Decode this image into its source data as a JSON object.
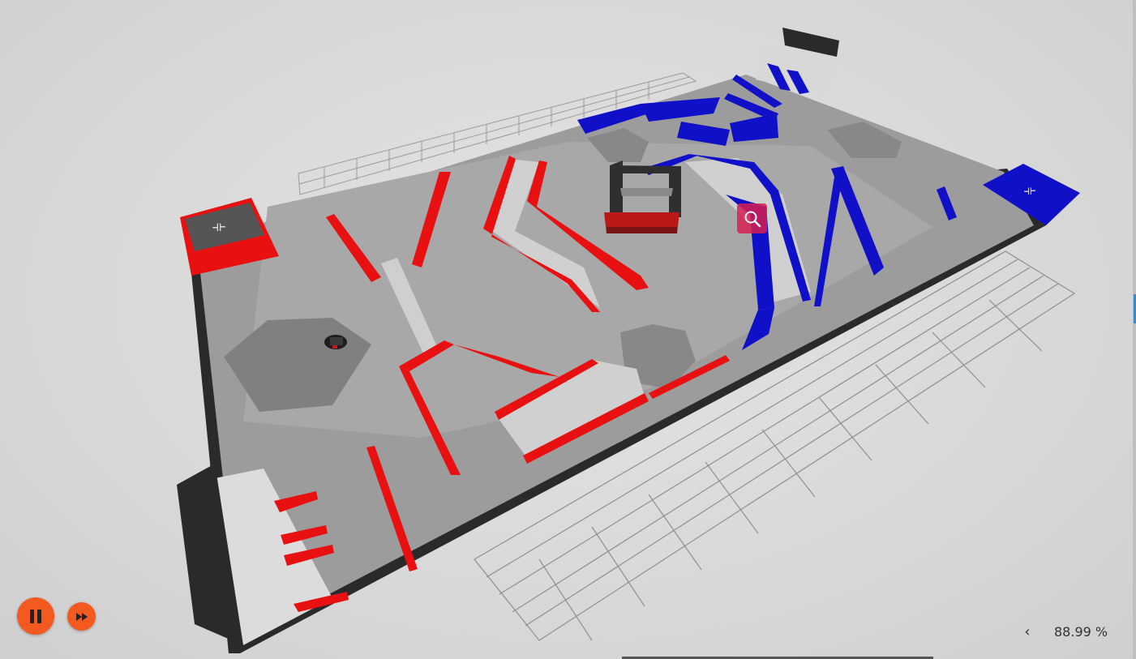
{
  "simulation": {
    "speed": "88.99 %",
    "collapse_label": "‹"
  },
  "icons": {
    "pause": "pause-icon",
    "fast_forward": "fast-forward-icon",
    "search": "magnifier-icon"
  },
  "colors": {
    "control_button": "#f45a1f",
    "red_alliance": "#e81010",
    "blue_alliance": "#1010c8",
    "search_overlay": "#d71e50",
    "floor": "#9a9a9a",
    "background": "#d9d9d9"
  }
}
